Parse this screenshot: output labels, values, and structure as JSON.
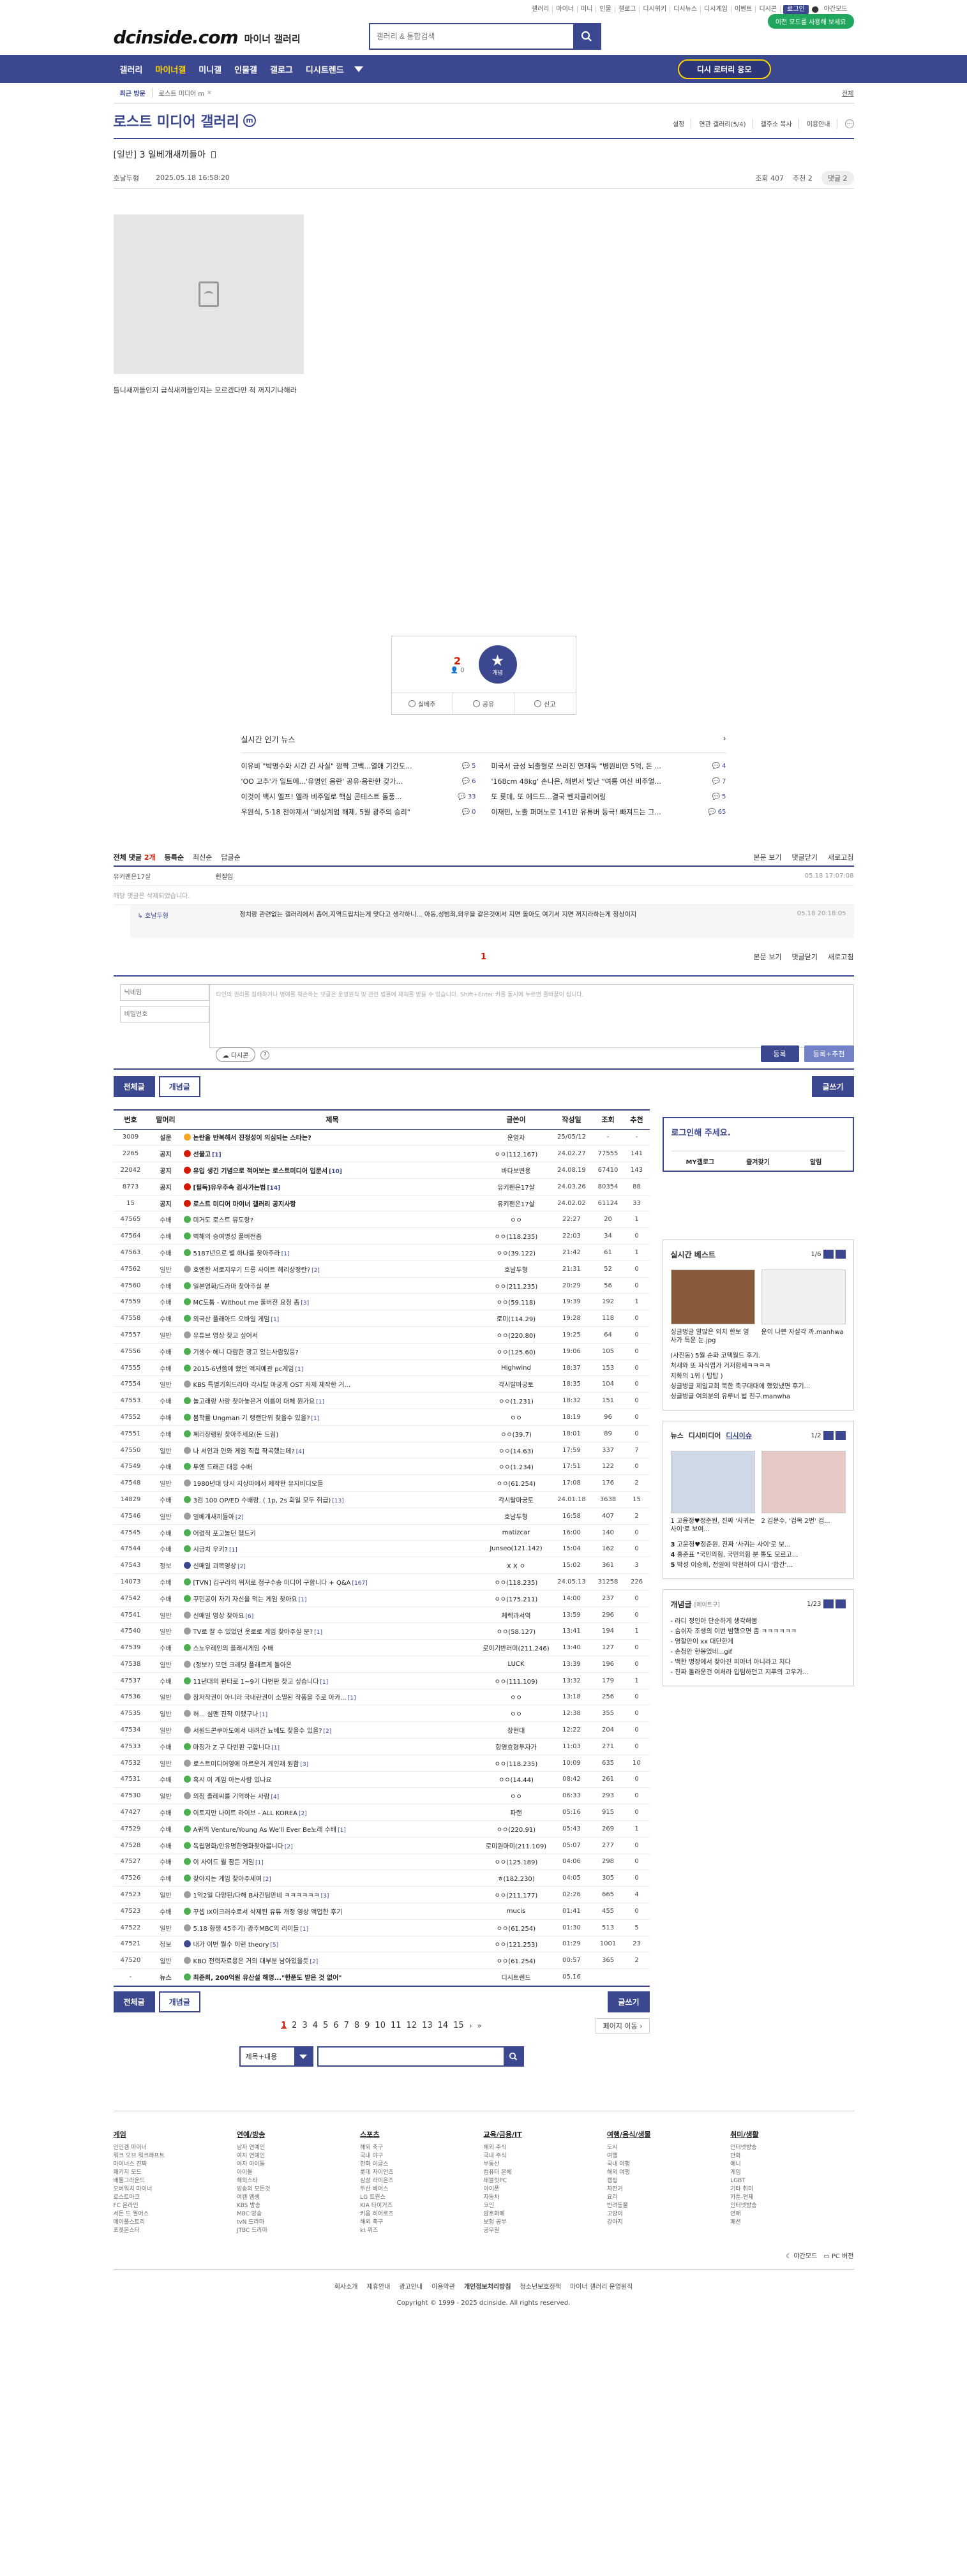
{
  "util": {
    "links": [
      "갤러리",
      "마이너",
      "미니",
      "인물",
      "갤로그",
      "디시위키",
      "디시뉴스",
      "디시게임",
      "이벤트",
      "디시콘"
    ],
    "login": "로그인",
    "night": "야간모드",
    "mode_btn": "이전 모드를 사용해 보세요"
  },
  "logo": {
    "text": "dcinside.com",
    "sub": "마이너 갤러리"
  },
  "search": {
    "placeholder": "갤러리 & 통합검색"
  },
  "gnb": {
    "items": [
      "갤러리",
      "마이너갤",
      "미니갤",
      "인물갤",
      "갤로그",
      "디시트렌드"
    ],
    "active": 1,
    "lottery": "디시 로터리 응모"
  },
  "visit": {
    "title": "최근 방문",
    "item": "로스트 미디어 m",
    "all": "전체"
  },
  "gallery": {
    "title": "로스트 미디어 갤러리",
    "badge": "m",
    "tools": [
      "설정",
      "연관 갤러리(5/4)",
      "갤주소 복사",
      "이용안내"
    ]
  },
  "post": {
    "head": "[일반]",
    "title": "3 일베개새끼들아",
    "author": "호날두형",
    "date": "2025.05.18 16:58:20",
    "views": "조회 407",
    "recommend": "추천 2",
    "comment_btn": "댓글 2",
    "body": "틀니새끼들인지 급식새끼들인지는 모르겠다만 척 꺼지기나해라"
  },
  "reco": {
    "up_count": "2",
    "fixed": "0",
    "star_label": "개념",
    "buttons": [
      "실베추",
      "공유",
      "신고"
    ]
  },
  "news": {
    "title": "실시간 인기 뉴스",
    "items": [
      {
        "t": "이유비 \"박명수와 시간 긴 사실\" 깜짝 고백...열애 기간도...",
        "c": "5"
      },
      {
        "t": "미국서 금성 뇌출혈로 쓰러진 연재독 \"병원비만 5억, 돈 ...",
        "c": "4"
      },
      {
        "t": "'OO 고추'가 일트에...'유명인 음란' 공유·음란한 갖가...",
        "c": "6"
      },
      {
        "t": "'168cm 48kg' 손나은, 해변서 빛난 \"여름 여신 비주얼...",
        "c": "7"
      },
      {
        "t": "이것이 백시 엘프! 엘라 비주얼로 핵심 콘테스트 돌풍...",
        "c": "33"
      },
      {
        "t": "또 롯데, 또 에드드...결국 벤치클리어링",
        "c": "5"
      },
      {
        "t": "우원식, 5·18 전야제서 \"비상계엄 해제, 5월 광주의 승리\"",
        "c": "0"
      },
      {
        "t": "이재민, 노출 퍼머노로 141만 유튜버 등극! 빠져드는 그...",
        "c": "65"
      }
    ]
  },
  "comments": {
    "total_label": "전체 댓글",
    "count": "2",
    "count_unit": "개",
    "order": [
      "등록순",
      "최신순",
      "답글순"
    ],
    "right": [
      "본문 보기",
      "댓글닫기",
      "새로고침"
    ],
    "rows": [
      {
        "name": "유키팬은17살",
        "text": "헌질임",
        "date": "05.18 17:07:08"
      }
    ],
    "deleted": "해당 댓글은 삭제되었습니다.",
    "reply": {
      "name": "호날두형",
      "text": "정치랑 관련없는 갤러리에서 좀어,지역드립치는게 맞다고 생각하니... 아동,성범죄,외우을 같은것에서 지면 돌아도 여기서 지면 꺼지라하는게 정상이지",
      "date": "05.18 20:18:05"
    },
    "page": "1",
    "nick_ph": "닉네임",
    "pw_ph": "비밀번호",
    "text_ph": "타인의 권리를 침해하거나 명예를 훼손하는 댓글은 운영원칙 및 관련 법률에 제재를 받을 수 있습니다. Shift+Enter 키를 동시에 누르면 줄바꿈이 됩니다.",
    "dccon": "디시콘",
    "submit": "등록",
    "submit_reco": "등록+추천"
  },
  "list_btns": {
    "all": "전체글",
    "concept": "개념글",
    "write": "글쓰기"
  },
  "table": {
    "headers": [
      "번호",
      "말머리",
      "제목",
      "글쓴이",
      "작성일",
      "조회",
      "추천"
    ],
    "rows": [
      {
        "no": "3009",
        "h": "설문",
        "t": "논란을 반복해서 진정성이 의심되는 스타는?",
        "r": "",
        "w": "운영자",
        "d": "25/05/12",
        "v": "-",
        "u": "-",
        "n": true,
        "ic": "y"
      },
      {
        "no": "2265",
        "h": "공지",
        "t": "선물고",
        "r": "[1]",
        "w": "ㅇㅇ(112.167)",
        "d": "24.02.27",
        "v": "77555",
        "u": "141",
        "n": true,
        "ic": "r"
      },
      {
        "no": "22042",
        "h": "공지",
        "t": "유입 생긴 기념으로 적어보는 로스트미디어 입문서",
        "r": "[10]",
        "w": "바다보변용",
        "d": "24.08.19",
        "v": "67410",
        "u": "143",
        "n": true,
        "ic": "r"
      },
      {
        "no": "8773",
        "h": "공지",
        "t": "[필독]유우주속 검사가는법",
        "r": "[14]",
        "w": "유키팬은17살",
        "d": "24.03.26",
        "v": "80354",
        "u": "88",
        "n": true,
        "ic": "r"
      },
      {
        "no": "15",
        "h": "공지",
        "t": "로스트 미디어 마이너 갤러리 공지사항",
        "r": "",
        "w": "유키팬은17살",
        "d": "24.02.02",
        "v": "61124",
        "u": "33",
        "n": true,
        "ic": "r"
      },
      {
        "no": "47565",
        "h": "수배",
        "t": "미거도 로스트 뮤도랑?",
        "r": "",
        "w": "ㅇㅇ",
        "d": "22:27",
        "v": "20",
        "u": "1",
        "n": false,
        "ic": "g"
      },
      {
        "no": "47564",
        "h": "수배",
        "t": "벽해의 승여명성 풀버전좀",
        "r": "",
        "w": "ㅇㅇ(118.235)",
        "d": "22:03",
        "v": "34",
        "u": "0",
        "n": false,
        "ic": "g"
      },
      {
        "no": "47563",
        "h": "수배",
        "t": "5187년으로 별 하나를 찾아주라",
        "r": "[1]",
        "w": "ㅇㅇ(39.122)",
        "d": "21:42",
        "v": "61",
        "u": "1",
        "n": false,
        "ic": "g"
      },
      {
        "no": "47562",
        "h": "일반",
        "t": "호엔한 서로지우기 드롱 사이트 헤리상정란?",
        "r": "[2]",
        "w": "호날두형",
        "d": "21:31",
        "v": "52",
        "u": "0",
        "n": false,
        "ic": "gr"
      },
      {
        "no": "47560",
        "h": "수배",
        "t": "일본영화/드라마 찾아주실 분",
        "r": "",
        "w": "ㅇㅇ(211.235)",
        "d": "20:29",
        "v": "56",
        "u": "0",
        "n": false,
        "ic": "g"
      },
      {
        "no": "47559",
        "h": "수배",
        "t": "MC도툼 - Without me 풀버전 요청 좀",
        "r": "[3]",
        "w": "ㅇㅇ(59.118)",
        "d": "19:39",
        "v": "192",
        "u": "1",
        "n": false,
        "ic": "g"
      },
      {
        "no": "47558",
        "h": "수배",
        "t": "외국산 플래아드 오바일 게임",
        "r": "[1]",
        "w": "로미(114.29)",
        "d": "19:28",
        "v": "118",
        "u": "0",
        "n": false,
        "ic": "g"
      },
      {
        "no": "47557",
        "h": "일반",
        "t": "유튜브 영상 찾고 싶어서",
        "r": "",
        "w": "ㅇㅇ(220.80)",
        "d": "19:25",
        "v": "64",
        "u": "0",
        "n": false,
        "ic": "gr"
      },
      {
        "no": "47556",
        "h": "수배",
        "t": "기생수 헤니 다람한 광고 있는사람있웅?",
        "r": "",
        "w": "ㅇㅇ(125.60)",
        "d": "19:06",
        "v": "105",
        "u": "0",
        "n": false,
        "ic": "g"
      },
      {
        "no": "47555",
        "h": "수배",
        "t": "2015-6년쯤에 했던 액저예관 pc게임",
        "r": "[1]",
        "w": "Highwind",
        "d": "18:37",
        "v": "153",
        "u": "0",
        "n": false,
        "ic": "g"
      },
      {
        "no": "47554",
        "h": "일반",
        "t": "KBS 특별기획드라마 각시탈 마궁게 OST 저제 제작한 거...",
        "r": "",
        "w": "각시탈마궁토",
        "d": "18:35",
        "v": "104",
        "u": "0",
        "n": false,
        "ic": "gr"
      },
      {
        "no": "47553",
        "h": "수배",
        "t": "놀고래랑 사랑 찾아놓은거 이름이 대체 뭔가요",
        "r": "[1]",
        "w": "ㅇㅇ(1.231)",
        "d": "18:32",
        "v": "151",
        "u": "0",
        "n": false,
        "ic": "g"
      },
      {
        "no": "47552",
        "h": "수배",
        "t": "봄학률 Ungman 기 랭랜단위 찾을수 있을?",
        "r": "[1]",
        "w": "ㅇㅇ",
        "d": "18:19",
        "v": "96",
        "u": "0",
        "n": false,
        "ic": "g"
      },
      {
        "no": "47551",
        "h": "수배",
        "t": "꼐리장랭원 찾아주세요(돈 드림)",
        "r": "",
        "w": "ㅇㅇ(39.7)",
        "d": "18:01",
        "v": "89",
        "u": "0",
        "n": false,
        "ic": "g"
      },
      {
        "no": "47550",
        "h": "일반",
        "t": "나 서인과 인와 게임 직접 작곡했는데?",
        "r": "[4]",
        "w": "ㅇㅇ(14.63)",
        "d": "17:59",
        "v": "337",
        "u": "7",
        "n": false,
        "ic": "gr"
      },
      {
        "no": "47549",
        "h": "수배",
        "t": "투엔 드래곤 대응 수배",
        "r": "",
        "w": "ㅇㅇ(1.234)",
        "d": "17:51",
        "v": "122",
        "u": "0",
        "n": false,
        "ic": "g"
      },
      {
        "no": "47548",
        "h": "일반",
        "t": "1980년대 당시 지상파에서 제작한 유지비디오들",
        "r": "",
        "w": "ㅇㅇ(61.254)",
        "d": "17:08",
        "v": "176",
        "u": "2",
        "n": false,
        "ic": "gr"
      },
      {
        "no": "14829",
        "h": "수배",
        "t": "3검 100 OP/ED 수배랑. ( 1p, 2s 회일 모두 취급)",
        "r": "[13]",
        "w": "각시탈마궁토",
        "d": "24.01.18",
        "v": "3638",
        "u": "15",
        "n": false,
        "ic": "g"
      },
      {
        "no": "47546",
        "h": "일반",
        "t": "일베개새끼들아",
        "r": "[2]",
        "w": "호날두형",
        "d": "16:58",
        "v": "407",
        "u": "2",
        "n": false,
        "ic": "gr"
      },
      {
        "no": "47545",
        "h": "수배",
        "t": "어렸적 포고놀던 헬드키",
        "r": "",
        "w": "matizcar",
        "d": "16:00",
        "v": "140",
        "u": "0",
        "n": false,
        "ic": "g"
      },
      {
        "no": "47544",
        "h": "수배",
        "t": "시금치 우키?",
        "r": "[1]",
        "w": "Junseo(121.142)",
        "d": "15:04",
        "v": "162",
        "u": "0",
        "n": false,
        "ic": "g"
      },
      {
        "no": "47543",
        "h": "정보",
        "t": "신매일 괴목영상",
        "r": "[2]",
        "w": "X X ㅇ",
        "d": "15:02",
        "v": "361",
        "u": "3",
        "n": false,
        "ic": "b"
      },
      {
        "no": "14073",
        "h": "수배",
        "t": "[TVN] 김구라의 위저로 첨구수송 미디어 구합니다 + Q&A",
        "r": "[167]",
        "w": "ㅇㅇ(118.235)",
        "d": "24.05.13",
        "v": "31258",
        "u": "226",
        "n": false,
        "ic": "g"
      },
      {
        "no": "47542",
        "h": "수배",
        "t": "꾸민공이 자기 자신을 먹는 게임 찾아요",
        "r": "[1]",
        "w": "ㅇㅇ(175.211)",
        "d": "14:00",
        "v": "237",
        "u": "0",
        "n": false,
        "ic": "g"
      },
      {
        "no": "47541",
        "h": "일반",
        "t": "신매일 영상 찾아요",
        "r": "[6]",
        "w": "체렉과서역",
        "d": "13:59",
        "v": "296",
        "u": "0",
        "n": false,
        "ic": "gr"
      },
      {
        "no": "47540",
        "h": "일반",
        "t": "TV로 찰 수 있었던 웃로로 게임 찾아주실 분?",
        "r": "[1]",
        "w": "ㅇㅇ(58.127)",
        "d": "13:41",
        "v": "194",
        "u": "1",
        "n": false,
        "ic": "gr"
      },
      {
        "no": "47539",
        "h": "수배",
        "t": "스노우레인의 플래시게임 수배",
        "r": "",
        "w": "로이기반러미(211.246)",
        "d": "13:40",
        "v": "127",
        "u": "0",
        "n": false,
        "ic": "g"
      },
      {
        "no": "47538",
        "h": "일반",
        "t": "(정보?) 모던 크레딧 플래르게 돌아온",
        "r": "",
        "w": "LUCK",
        "d": "13:39",
        "v": "196",
        "u": "0",
        "n": false,
        "ic": "gr"
      },
      {
        "no": "47537",
        "h": "수배",
        "t": "11년대의 판타로 1~9기 다번판 찾고 싶습니다",
        "r": "[1]",
        "w": "ㅇㅇ(111.109)",
        "d": "13:32",
        "v": "179",
        "u": "1",
        "n": false,
        "ic": "g"
      },
      {
        "no": "47536",
        "h": "일반",
        "t": "참저작권이 아니라 국내란권이 소멸된 작품을 주로 아카...",
        "r": "[1]",
        "w": "ㅇㅇ",
        "d": "13:18",
        "v": "256",
        "u": "0",
        "n": false,
        "ic": "gr"
      },
      {
        "no": "47535",
        "h": "일반",
        "t": "허... 심맨 진작 이랬구나",
        "r": "[1]",
        "w": "ㅇㅇ",
        "d": "12:38",
        "v": "355",
        "u": "0",
        "n": false,
        "ic": "gr"
      },
      {
        "no": "47534",
        "h": "일반",
        "t": "서원드콘쿠아도에서 내려간 뇨베도 찾을수 있을?",
        "r": "[2]",
        "w": "창현대",
        "d": "12:22",
        "v": "204",
        "u": "0",
        "n": false,
        "ic": "gr"
      },
      {
        "no": "47533",
        "h": "수배",
        "t": "마징가 Z 구 다빈판 구합니다",
        "r": "[1]",
        "w": "항영효형투자가",
        "d": "11:03",
        "v": "271",
        "u": "0",
        "n": false,
        "ic": "g"
      },
      {
        "no": "47532",
        "h": "일반",
        "t": "로스트미디어영에 마르운거 게인재 원함",
        "r": "[3]",
        "w": "ㅇㅇ(118.235)",
        "d": "10:09",
        "v": "635",
        "u": "10",
        "n": false,
        "ic": "gr"
      },
      {
        "no": "47531",
        "h": "수배",
        "t": "혹시 이 게임 아는사람 있나요",
        "r": "",
        "w": "ㅇㅇ(14.44)",
        "d": "08:42",
        "v": "261",
        "u": "0",
        "n": false,
        "ic": "g"
      },
      {
        "no": "47530",
        "h": "일반",
        "t": "의정 졸레씨를 기억하는 사람",
        "r": "[4]",
        "w": "ㅇㅇ",
        "d": "06:33",
        "v": "293",
        "u": "0",
        "n": false,
        "ic": "gr"
      },
      {
        "no": "47427",
        "h": "수배",
        "t": "이토지만 나이트 라이브 - ALL KOREA",
        "r": "[2]",
        "w": "파랜",
        "d": "05:16",
        "v": "915",
        "u": "0",
        "n": false,
        "ic": "g"
      },
      {
        "no": "47529",
        "h": "수배",
        "t": "A퀴의 Venture/Young As We'll Ever Be노래 수배",
        "r": "[1]",
        "w": "ㅇㅇ(220.91)",
        "d": "05:43",
        "v": "269",
        "u": "1",
        "n": false,
        "ic": "g"
      },
      {
        "no": "47528",
        "h": "수배",
        "t": "독립영화/안유명한영화찾아봅니다",
        "r": "[2]",
        "w": "로미원마미(211.109)",
        "d": "05:07",
        "v": "277",
        "u": "0",
        "n": false,
        "ic": "g"
      },
      {
        "no": "47527",
        "h": "수배",
        "t": "이 사이드 뭘 잠든 게임",
        "r": "[1]",
        "w": "ㅇㅇ(125.189)",
        "d": "04:06",
        "v": "298",
        "u": "0",
        "n": false,
        "ic": "g"
      },
      {
        "no": "47526",
        "h": "수배",
        "t": "찾아지는 게임 찾아주세여",
        "r": "[2]",
        "w": "ㅎ(182.230)",
        "d": "04:05",
        "v": "305",
        "u": "0",
        "n": false,
        "ic": "g"
      },
      {
        "no": "47523",
        "h": "일반",
        "t": "1억2일 다양된/다해 B사건팀만네 ㅋㅋㅋㅋㅋㅋ",
        "r": "[3]",
        "w": "ㅇㅇ(211.177)",
        "d": "02:26",
        "v": "665",
        "u": "4",
        "n": false,
        "ic": "gr"
      },
      {
        "no": "47523",
        "h": "수배",
        "t": "꾸셉 Ⅸ이크러수로서 삭제된 유튜 개정 영상 액업한 후기",
        "r": "",
        "w": "mucis",
        "d": "01:41",
        "v": "455",
        "u": "0",
        "n": false,
        "ic": "g"
      },
      {
        "no": "47522",
        "h": "일반",
        "t": "5.18 항쟁 45주기) 광주MBC의 리이들",
        "r": "[1]",
        "w": "ㅇㅇ(61.254)",
        "d": "01:30",
        "v": "513",
        "u": "5",
        "n": false,
        "ic": "gr"
      },
      {
        "no": "47521",
        "h": "정보",
        "t": "내가 이번 뭘수 이런 theory",
        "r": "[5]",
        "w": "ㅇㅇ(121.253)",
        "d": "01:29",
        "v": "1001",
        "u": "23",
        "n": false,
        "ic": "b"
      },
      {
        "no": "47520",
        "h": "일반",
        "t": "KBO 전력자료용은 거의 대부분 남아있을듯",
        "r": "[2]",
        "w": "ㅇㅇ(61.254)",
        "d": "00:57",
        "v": "365",
        "u": "2",
        "n": false,
        "ic": "gr"
      },
      {
        "no": "-",
        "h": "뉴스",
        "t": "최준희, 200억원 유산설 해명...\"한푼도 받은 것 없어\"",
        "r": "",
        "w": "디시트렌드",
        "d": "05.16",
        "v": "",
        "u": "",
        "n": true,
        "ic": "g"
      }
    ]
  },
  "paging": {
    "pages": [
      "1",
      "2",
      "3",
      "4",
      "5",
      "6",
      "7",
      "8",
      "9",
      "10",
      "11",
      "12",
      "13",
      "14",
      "15"
    ],
    "next_label": "페이지 이동"
  },
  "bsearch": {
    "select": "제목+내용"
  },
  "side": {
    "login": "로그인해 주세요.",
    "login_links": [
      "MY갤로그",
      "즐겨찾기",
      "알림"
    ],
    "best": {
      "title": "실시간 베스트",
      "page": "1/6",
      "thumbs": [
        {
          "cap": "싱글벙글 말많은 외치 한보 영사가 특운 눈.jpg"
        },
        {
          "cap": "운이 나쁜 자살각 까.manhwa"
        }
      ],
      "list": [
        "(사진동) 5월 순화 코택월드 후기.",
        "처새와 또 자식엽가 거저합세ㅋㅋㅋㅋ",
        "지화의 1위 ( 탑탑 )",
        "싱글벙글 제일교회 북한 축구대대에 했었냈면 후기...",
        "싱글벙글 여의분의 유루너 법 친구.manwha"
      ]
    },
    "people": {
      "tabs": [
        "뉴스",
        "디시미디어",
        "디시이슈"
      ],
      "page": "1/2",
      "list": [
        {
          "no": "3",
          "t": "고윤정♥정준원, 진짜 '사귀는 사이'로 보..."
        },
        {
          "no": "4",
          "t": "홍준표 \"국민의힘, 국민의힘 분 통도 모르고..."
        },
        {
          "no": "5",
          "t": "박성 이승희, 전일에 악천하여 다시 '합간'..."
        }
      ],
      "caps": [
        "1 고윤정♥정준원, 진짜 '사귀는 사이'로 보여...",
        "2 김문수, '검목 2번' 검..."
      ]
    },
    "concept": {
      "title": "개념글",
      "sub": "[에이트구]",
      "page": "1/23",
      "list": [
        "- 라디 정인아 단순하게 생각해봄",
        "- 숨쉬자 조생의 이번 밤했으면 좀 ㅋㅋㅋㅋㅋㅋ",
        "- 영할만이 xx 대단한게",
        "- 손청안 한봉었네...gif",
        "- 백한 명장에서 찾아진 피아너 아니라고 치다",
        "- 진짜 돌라운건 여처라 입팀하던고 지푸의 고우가..."
      ]
    }
  },
  "footer": {
    "cols": [
      {
        "h": "게임",
        "items": [
          "인인겜 마이너",
          "워크 오브 워크래프트",
          "마이너스 진짜",
          "패키지 모드",
          "배틀그라운드",
          "오버워치 마이너",
          "로스트아크",
          "FC 온라인",
          "서든 드 월어스",
          "메이플스토리",
          "포켓몬스터"
        ]
      },
      {
        "h": "연예/방송",
        "items": [
          "남자 연예인",
          "여자 연예인",
          "여자 아이돌",
          "아이돌",
          "해외스타",
          "방송의 모든것",
          "여캠 엠셍",
          "KBS 방송",
          "MBC 방송",
          "tvN 드라마",
          "JTBC 드라마"
        ]
      },
      {
        "h": "스포츠",
        "items": [
          "해외 축구",
          "국내 야구",
          "한화 이글스",
          "롯데 자이언츠",
          "삼성 라이온즈",
          "두산 베어스",
          "LG 트윈스",
          "KIA 타이거즈",
          "키움 히어로즈",
          "해외 축구",
          "kt 위즈"
        ]
      },
      {
        "h": "교육/금융/IT",
        "items": [
          "해외 주식",
          "국내 주식",
          "부동산",
          "컴퓨터 본체",
          "태블릿PC",
          "아이폰",
          "자동차",
          "코인",
          "암호화폐",
          "보험 공부",
          "공무원"
        ]
      },
      {
        "h": "여행/음식/생물",
        "items": [
          "도시",
          "여행",
          "국내 여행",
          "해외 여행",
          "캠핑",
          "자전거",
          "요리",
          "반려동물",
          "고양이",
          "강아지"
        ]
      },
      {
        "h": "취미/생활",
        "items": [
          "인터넷방송",
          "만화",
          "애니",
          "게임",
          "LGBT",
          "기타 취미",
          "카툰-연재",
          "인터넷방송",
          "연애",
          "패션"
        ]
      }
    ],
    "night": "야간모드",
    "pc": "PC 버전",
    "links": [
      "회사소개",
      "제휴안내",
      "광고안내",
      "이용약관",
      "개인정보처리방침",
      "청소년보호정책",
      "마이너 갤러리 운영원칙"
    ],
    "copy": "Copyright © 1999 - 2025 dcinside. All rights reserved."
  }
}
